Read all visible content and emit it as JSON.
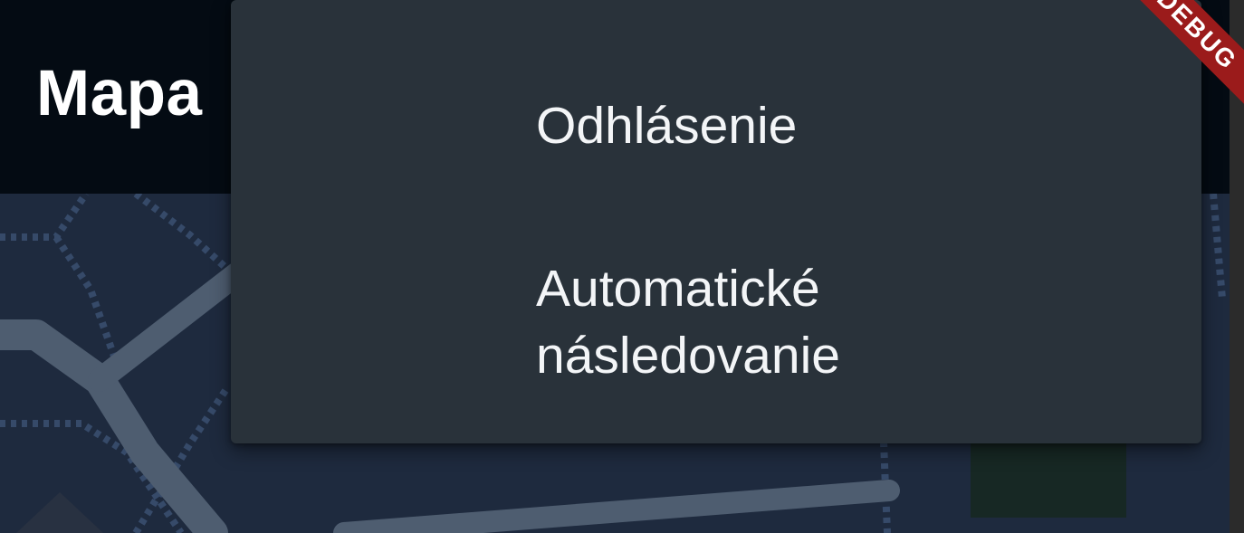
{
  "appbar": {
    "title": "Mapa"
  },
  "menu": {
    "items": [
      {
        "label": "Odhlásenie"
      },
      {
        "label": "Automatické\nnásledovanie"
      }
    ]
  },
  "banner": {
    "label": "DEBUG"
  },
  "colors": {
    "background": "#1e2a3e",
    "appbar": "#040b13",
    "menu": "#29323a",
    "text": "#f3f5f7",
    "banner": "#9b1b1b",
    "roads": "#4e5d70",
    "paths": "#364a69",
    "park": "#172824"
  },
  "icons": {
    "map": "map-view"
  }
}
